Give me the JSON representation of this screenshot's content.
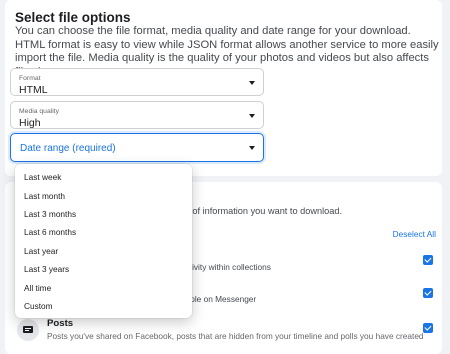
{
  "section": {
    "heading": "Select file options",
    "description": "You can choose the file format, media quality and date range for your download. HTML format is easy to view while JSON format allows another service to more easily import the file. Media quality is the quality of your photos and videos but also affects file size."
  },
  "format": {
    "label": "Format",
    "value": "HTML",
    "icon": "chevron-down-icon"
  },
  "quality": {
    "label": "Media quality",
    "value": "High",
    "icon": "chevron-down-icon"
  },
  "date_range": {
    "placeholder": "Date range (required)",
    "icon": "chevron-down-icon"
  },
  "date_options": [
    "Last week",
    "Last month",
    "Last 3 months",
    "Last 6 months",
    "Last year",
    "Last 3 years",
    "All time",
    "Custom"
  ],
  "info_section": {
    "intro_partial": "pes of information you want to download.",
    "deselect_all": "Deselect All",
    "row1_partial": "activity within collections",
    "row2_partial": "eople on Messenger",
    "posts_title": "Posts",
    "posts_desc": "Posts you've shared on Facebook, posts that are hidden from your timeline and polls you have created"
  },
  "colors": {
    "accent": "#1b74e4",
    "background": "#f0f2f5",
    "card": "#ffffff"
  }
}
